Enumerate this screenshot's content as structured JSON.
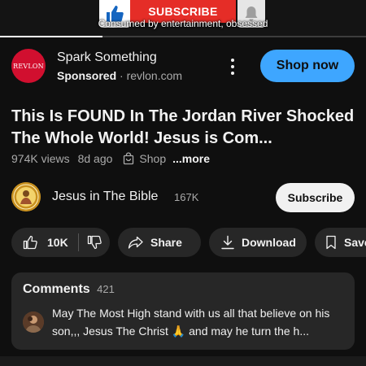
{
  "player": {
    "subscribe_banner": "SUBSCRIBE",
    "caption": "Consumed by entertainment, obsessed",
    "progress_fraction": 0.28
  },
  "ad": {
    "logo_text": "REVLON",
    "title": "Spark Something",
    "sponsored_label": "Sponsored",
    "separator": "·",
    "domain": "revlon.com",
    "cta_label": "Shop now"
  },
  "video": {
    "title": "This Is FOUND In The Jordan River Shocked The Whole World! Jesus is Com...",
    "views": "974K views",
    "age": "8d ago",
    "shop_label": "Shop",
    "more_label": "...more"
  },
  "channel": {
    "name": "Jesus in The Bible",
    "subscribers": "167K",
    "subscribe_label": "Subscribe"
  },
  "actions": {
    "like_count": "10K",
    "share_label": "Share",
    "download_label": "Download",
    "save_label": "Save"
  },
  "comments": {
    "label": "Comments",
    "count": "421",
    "top_comment": "May The Most High stand with us all that believe on his son,,, Jesus The Christ 🙏 and may he turn the h..."
  },
  "icons": {
    "like": "thumbs-up-icon",
    "dislike": "thumbs-down-icon",
    "share": "share-arrow-icon",
    "download": "download-icon",
    "save": "bookmark-icon",
    "shop": "shopping-bag-icon",
    "more": "kebab-menu-icon",
    "bell": "bell-icon"
  },
  "colors": {
    "background": "#0f0f0f",
    "pill": "#272727",
    "accent_blue": "#3ea6ff",
    "subscribe_red": "#e52d27",
    "revlon_red": "#d10f2f"
  }
}
